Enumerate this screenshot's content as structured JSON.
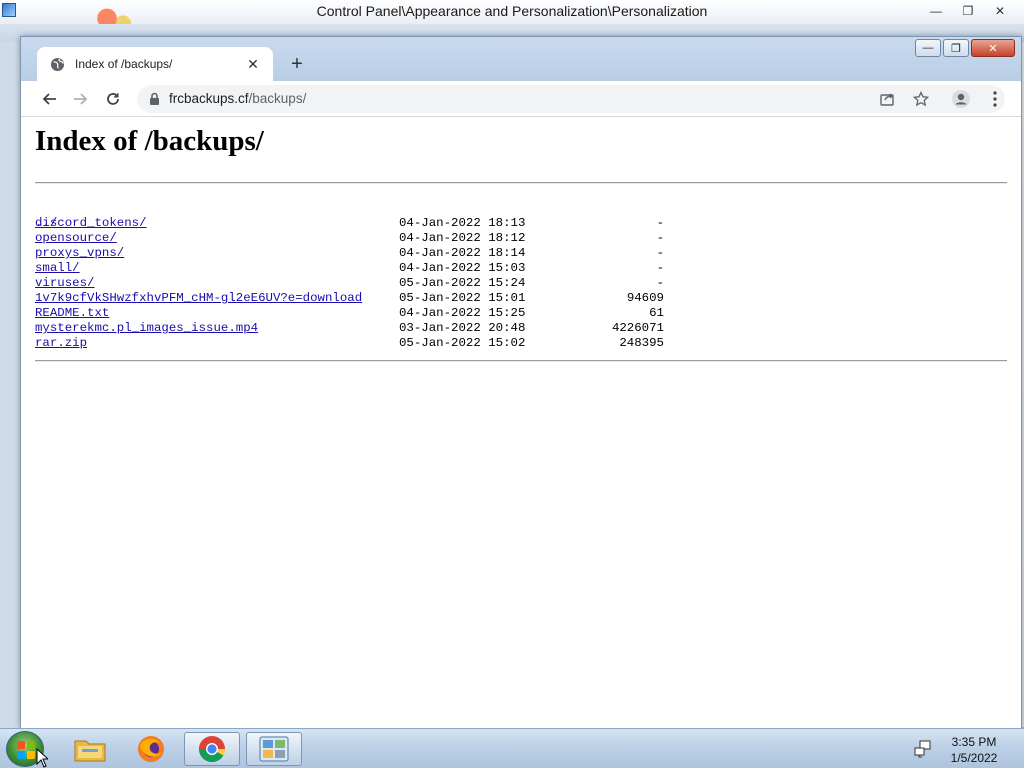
{
  "background_window": {
    "title": "Control Panel\\Appearance and Personalization\\Personalization",
    "controls": [
      "minimize",
      "restore",
      "close"
    ]
  },
  "browser": {
    "tab": {
      "title": "Index of /backups/",
      "favicon": "globe-icon"
    },
    "new_tab_symbol": "+",
    "address": {
      "host": "frcbackups.cf",
      "path": "/backups/",
      "secure_icon": "lock-icon"
    },
    "toolbar_icons": [
      "back-icon",
      "forward-icon",
      "reload-icon",
      "share-icon",
      "bookmark-star-icon",
      "profile-icon",
      "menu-icon"
    ]
  },
  "page": {
    "heading": "Index of /backups/",
    "parent_link": "../",
    "entries": [
      {
        "name": "discord_tokens/",
        "date": "04-Jan-2022 18:13",
        "size": "-"
      },
      {
        "name": "opensource/",
        "date": "04-Jan-2022 18:12",
        "size": "-"
      },
      {
        "name": "proxys_vpns/",
        "date": "04-Jan-2022 18:14",
        "size": "-"
      },
      {
        "name": "small/",
        "date": "04-Jan-2022 15:03",
        "size": "-"
      },
      {
        "name": "viruses/",
        "date": "05-Jan-2022 15:24",
        "size": "-"
      },
      {
        "name": "1v7k9cfVkSHwzfxhvPFM_cHM-gl2eE6UV?e=download",
        "date": "05-Jan-2022 15:01",
        "size": "94609"
      },
      {
        "name": "README.txt",
        "date": "04-Jan-2022 15:25",
        "size": "61"
      },
      {
        "name": "mysterekmc.pl_images_issue.mp4",
        "date": "03-Jan-2022 20:48",
        "size": "4226071"
      },
      {
        "name": "rar.zip",
        "date": "05-Jan-2022 15:02",
        "size": "248395"
      }
    ]
  },
  "taskbar": {
    "apps": [
      "start-orb",
      "file-explorer",
      "firefox",
      "chrome",
      "control-panel"
    ],
    "active_app": "chrome",
    "clock_time": "3:35 PM",
    "clock_date": "1/5/2022"
  },
  "colors": {
    "link": "#1a0dab",
    "taskbar": "#bcd0e6",
    "close_button": "#c7432a"
  }
}
